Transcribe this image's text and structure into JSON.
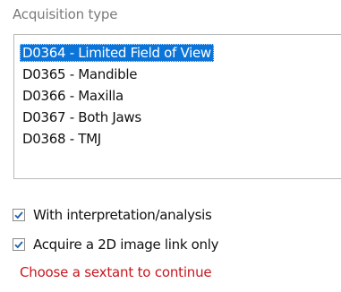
{
  "acquisition": {
    "title": "Acquisition type",
    "options": [
      {
        "label": "D0364 - Limited Field of View",
        "selected": true
      },
      {
        "label": "D0365 - Mandible",
        "selected": false
      },
      {
        "label": "D0366 - Maxilla",
        "selected": false
      },
      {
        "label": "D0367 - Both Jaws",
        "selected": false
      },
      {
        "label": "D0368 - TMJ",
        "selected": false
      }
    ]
  },
  "options": {
    "interpretation": {
      "label": "With interpretation/analysis",
      "checked": true
    },
    "image_link": {
      "label": "Acquire a 2D image link only",
      "checked": true
    }
  },
  "status": {
    "warning": "Choose a sextant to continue"
  },
  "colors": {
    "selection": "#0a74d9",
    "warning": "#c8161d",
    "check": "#1e5fa8"
  }
}
